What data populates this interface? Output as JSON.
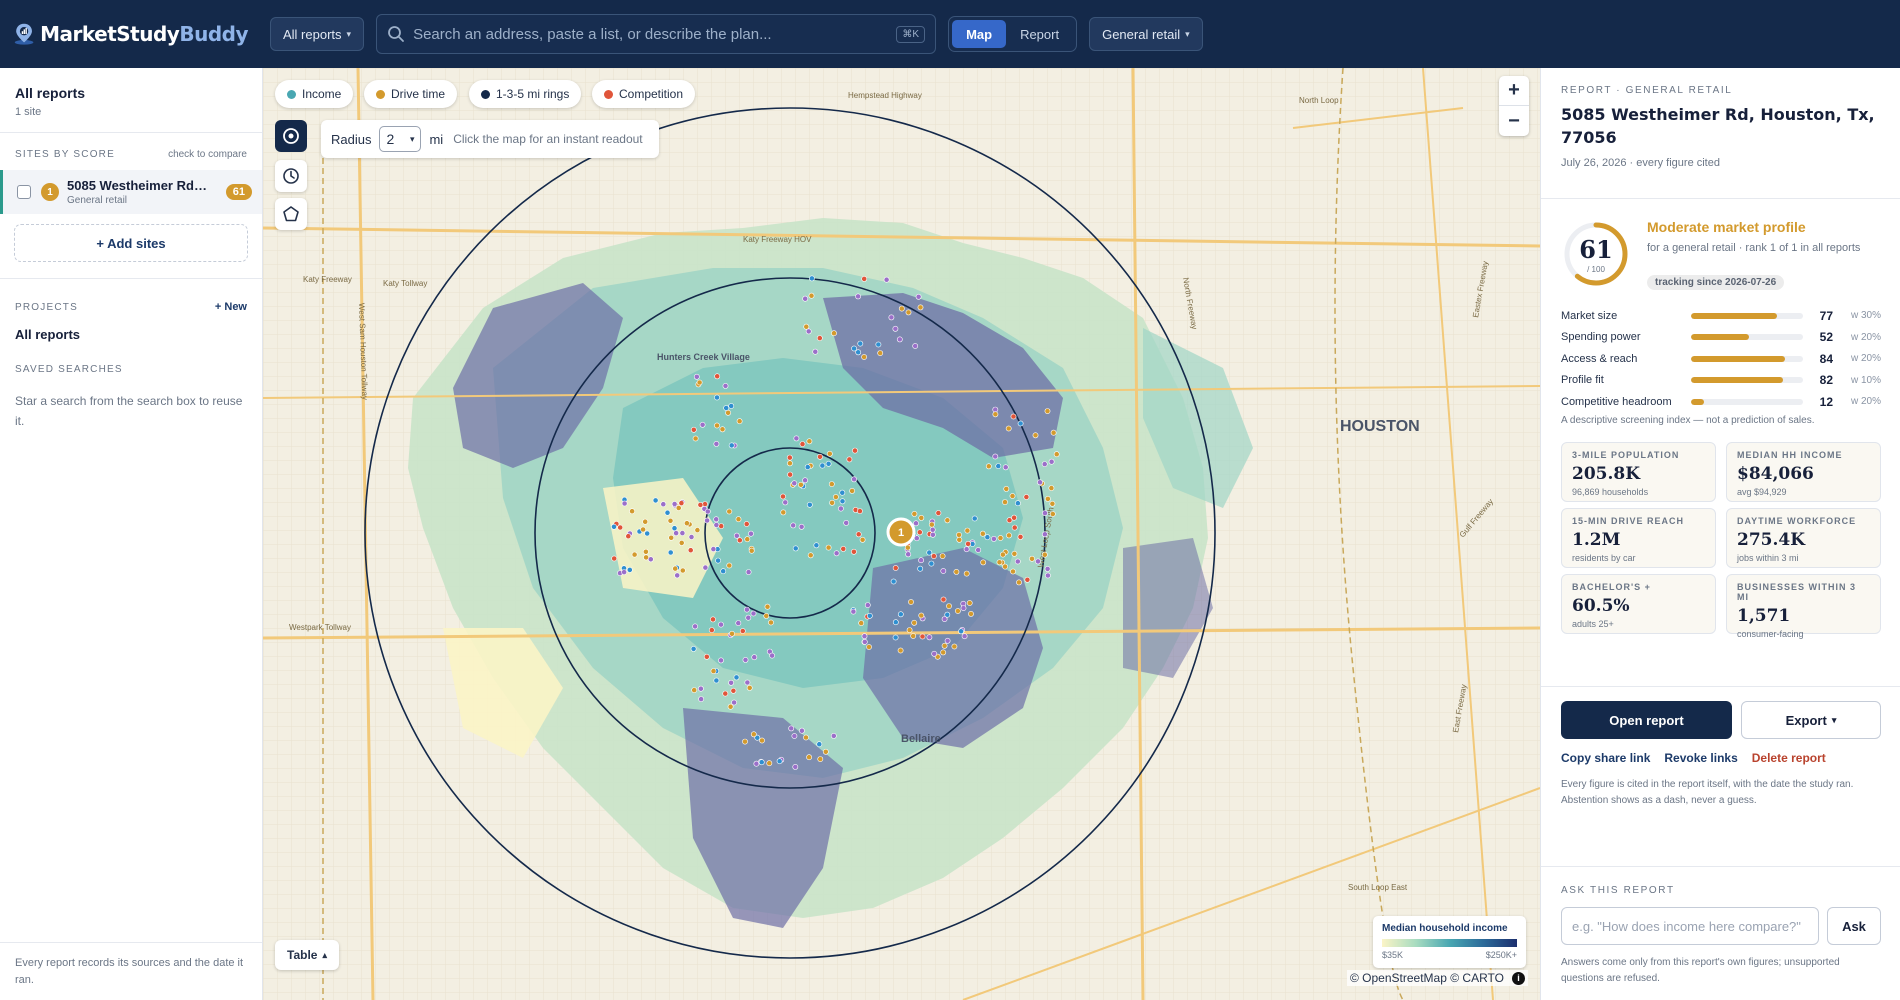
{
  "header": {
    "brand_main": "MarketStudy",
    "brand_accent": "Buddy",
    "reports_dropdown": "All reports",
    "search_placeholder": "Search an address, paste a list, or describe the plan...",
    "shortcut": "⌘K",
    "view_tabs": [
      {
        "label": "Map",
        "active": true
      },
      {
        "label": "Report",
        "active": false
      }
    ],
    "category_dropdown": "General retail"
  },
  "sidebar": {
    "title": "All reports",
    "subtitle": "1 site",
    "sites_heading": "SITES BY SCORE",
    "sites_hint": "check to compare",
    "sites": [
      {
        "rank": "1",
        "name": "5085 Westheimer Rd, Houston",
        "category": "General retail",
        "score": "61"
      }
    ],
    "add_sites": "+ Add sites",
    "projects_heading": "PROJECTS",
    "new_project": "+ New",
    "project_item": "All reports",
    "saved_heading": "SAVED SEARCHES",
    "saved_hint": "Star a search from the search box to reuse it.",
    "footer": "Every report records its sources and the date it ran."
  },
  "map": {
    "layers": [
      {
        "label": "Income",
        "color": "#49a7b2"
      },
      {
        "label": "Drive time",
        "color": "#d39a2d"
      },
      {
        "label": "1-3-5 mi rings",
        "color": "#14294a"
      },
      {
        "label": "Competition",
        "color": "#e0553a"
      }
    ],
    "radius_label": "Radius",
    "radius_value": "2",
    "radius_unit": "mi",
    "radius_hint": "Click the map for an instant readout",
    "zoom_in": "+",
    "zoom_out": "−",
    "table_button": "Table",
    "legend_title": "Median household income",
    "legend_min": "$35K",
    "legend_max": "$250K+",
    "attribution": "© OpenStreetMap © CARTO",
    "marker_label": "1",
    "place_labels": {
      "city": "HOUSTON",
      "hunters_creek": "Hunters Creek Village",
      "bellaire": "Bellaire",
      "katy_freeway": "Katy Freeway",
      "katy_tollway": "Katy Tollway",
      "westpark": "Westpark Tollway",
      "north_loop": "North Loop",
      "south_loop": "South Loop East",
      "gulf_freeway": "Gulf Freeway",
      "eastex": "Eastex Freeway",
      "sam_houston": "West Sam Houston Tollway",
      "katy_freeway_hov": "Katy Freeway HOV",
      "hempstead": "Hempstead Highway",
      "west_loop": "West Loop South",
      "north_freeway": "North Freeway",
      "east_freeway": "East Freeway"
    }
  },
  "report": {
    "kicker": "REPORT · GENERAL RETAIL",
    "title": "5085 Westheimer Rd, Houston, Tx, 77056",
    "date": "July 26, 2026 · every figure cited",
    "score": "61",
    "score_fraction": 0.61,
    "score_denominator": "/ 100",
    "profile_title": "Moderate market profile",
    "profile_sub": "for a general retail · rank 1 of 1 in all reports",
    "tracking": "tracking since 2026-07-26",
    "accent_color": "#d39a2d",
    "metrics": [
      {
        "label": "Market size",
        "value": "77",
        "fraction": 0.77,
        "weight": "w 30%"
      },
      {
        "label": "Spending power",
        "value": "52",
        "fraction": 0.52,
        "weight": "w 20%"
      },
      {
        "label": "Access & reach",
        "value": "84",
        "fraction": 0.84,
        "weight": "w 20%"
      },
      {
        "label": "Profile fit",
        "value": "82",
        "fraction": 0.82,
        "weight": "w 10%"
      },
      {
        "label": "Competitive headroom",
        "value": "12",
        "fraction": 0.12,
        "weight": "w 20%"
      }
    ],
    "disclaimer": "A descriptive screening index — not a prediction of sales.",
    "cards": [
      {
        "key": "3-MILE POPULATION",
        "value": "205.8K",
        "sub": "96,869 households"
      },
      {
        "key": "MEDIAN HH INCOME",
        "value": "$84,066",
        "sub": "avg $94,929"
      },
      {
        "key": "15-MIN DRIVE REACH",
        "value": "1.2M",
        "sub": "residents by car"
      },
      {
        "key": "DAYTIME WORKFORCE",
        "value": "275.4K",
        "sub": "jobs within 3 mi"
      },
      {
        "key": "BACHELOR'S +",
        "value": "60.5%",
        "sub": "adults 25+"
      },
      {
        "key": "BUSINESSES WITHIN 3 MI",
        "value": "1,571",
        "sub": "consumer-facing"
      }
    ],
    "open_report": "Open report",
    "export": "Export",
    "copy_link": "Copy share link",
    "revoke_links": "Revoke links",
    "delete_report": "Delete report",
    "note": "Every figure is cited in the report itself, with the date the study ran. Abstention shows as a dash, never a guess.",
    "ask_heading": "ASK THIS REPORT",
    "ask_placeholder": "e.g. \"How does income here compare?\"",
    "ask_button": "Ask",
    "ask_note": "Answers come only from this report's own figures; unsupported questions are refused."
  }
}
